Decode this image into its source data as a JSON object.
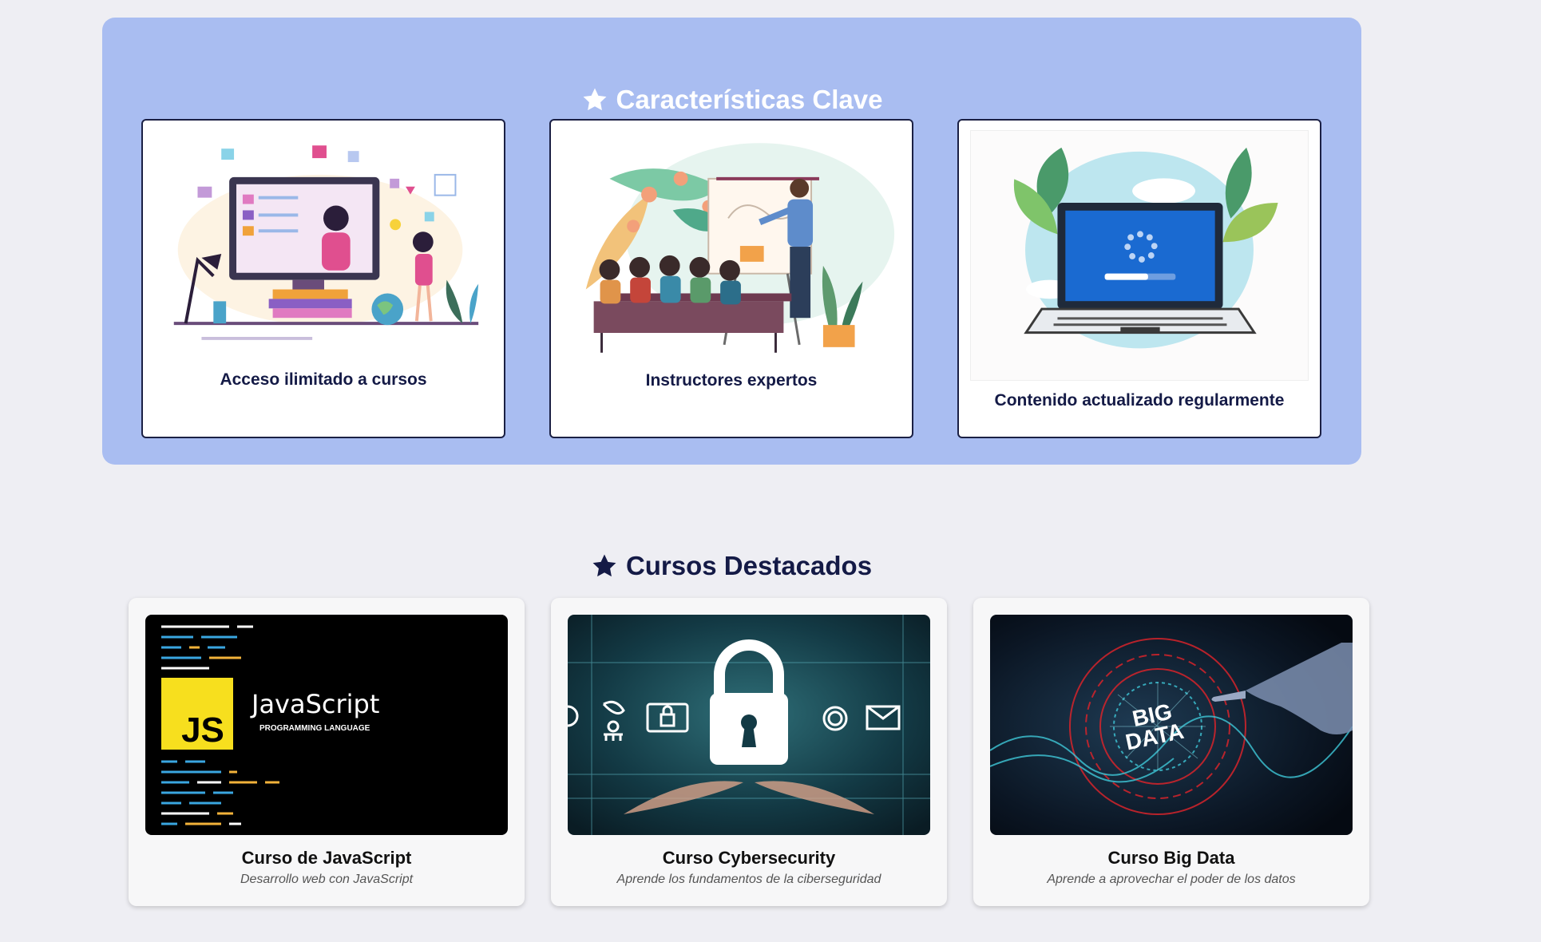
{
  "features": {
    "title": "Características Clave",
    "icon": "star-icon",
    "items": [
      {
        "label": "Acceso ilimitado a cursos",
        "image": "online-learning-illustration"
      },
      {
        "label": "Instructores expertos",
        "image": "instructor-presentation-illustration"
      },
      {
        "label": "Contenido actualizado regularmente",
        "image": "laptop-updating-illustration"
      }
    ]
  },
  "courses": {
    "title": "Cursos Destacados",
    "icon": "star-icon",
    "items": [
      {
        "title": "Curso de JavaScript",
        "subtitle": "Desarrollo web con JavaScript",
        "image": "javascript-banner",
        "logo_text": "JS",
        "banner_title": "JavaScript",
        "banner_subtitle": "PROGRAMMING LANGUAGE"
      },
      {
        "title": "Curso Cybersecurity",
        "subtitle": "Aprende los fundamentos de la ciberseguridad",
        "image": "cybersecurity-lock-image"
      },
      {
        "title": "Curso Big Data",
        "subtitle": "Aprende a aprovechar el poder de los datos",
        "image": "big-data-image",
        "logo_line1": "BIG",
        "logo_line2": "DATA"
      }
    ]
  },
  "colors": {
    "page_background": "#eeeef3",
    "features_background": "#a9bdf1",
    "heading_dark": "#141a46",
    "js_yellow": "#f7df1e"
  }
}
